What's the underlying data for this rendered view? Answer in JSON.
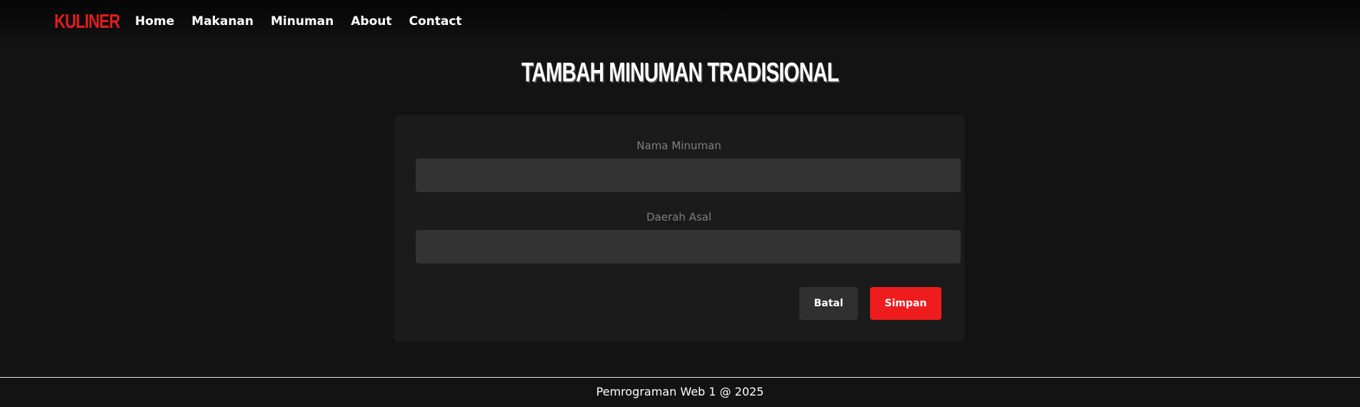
{
  "navbar": {
    "brand": "KULINER",
    "links": [
      {
        "label": "Home"
      },
      {
        "label": "Makanan"
      },
      {
        "label": "Minuman"
      },
      {
        "label": "About"
      },
      {
        "label": "Contact"
      }
    ]
  },
  "page": {
    "title": "TAMBAH MINUMAN TRADISIONAL"
  },
  "form": {
    "fields": [
      {
        "label": "Nama Minuman",
        "value": "",
        "placeholder": ""
      },
      {
        "label": "Daerah Asal",
        "value": "",
        "placeholder": ""
      }
    ],
    "cancel_label": "Batal",
    "save_label": "Simpan"
  },
  "footer": {
    "text": "Pemrograman Web 1 @ 2025"
  },
  "colors": {
    "background": "#131313",
    "card": "#1b1b1b",
    "input": "#333333",
    "accent": "#ee1c1c",
    "brand": "#e11d1d",
    "cancel_button": "#303030"
  }
}
